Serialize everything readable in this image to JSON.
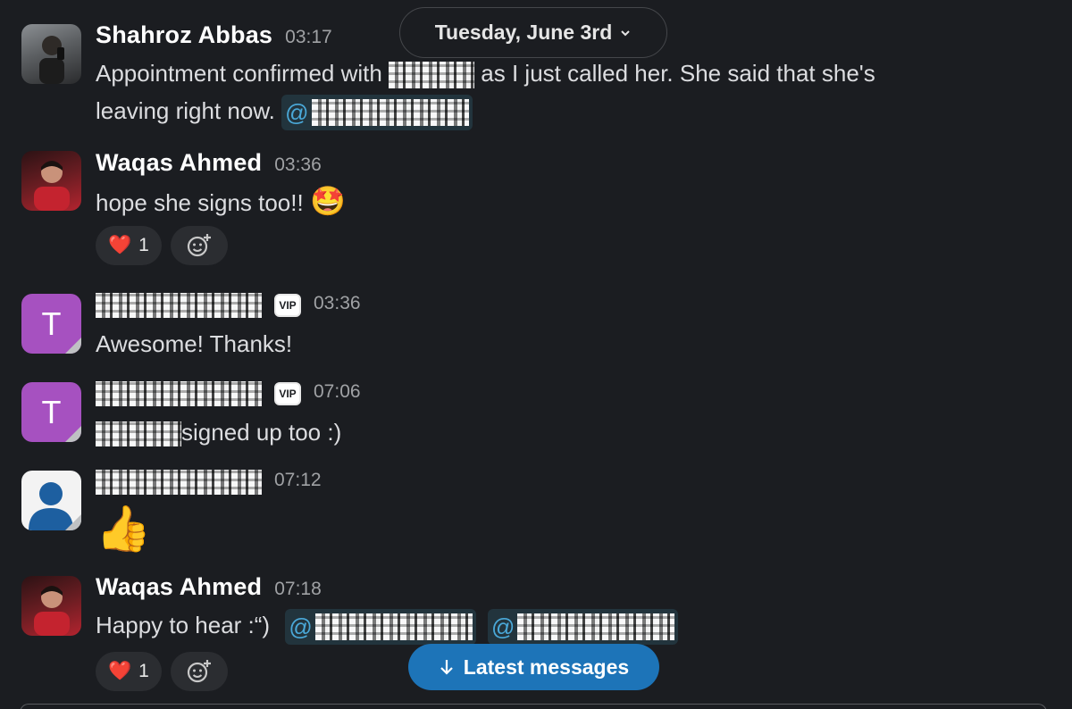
{
  "date_pill": {
    "label": "Tuesday, June 3rd",
    "chevron": "chevron-down-icon"
  },
  "messages": [
    {
      "author": "Shahroz Abbas",
      "time": "03:17",
      "text_a": "Appointment confirmed with",
      "text_b": "as I just called her. She said that she's",
      "text_c": "leaving right now.",
      "mention_prefix": "@"
    },
    {
      "author": "Waqas Ahmed",
      "time": "03:36",
      "text": "hope she signs too!!",
      "emoji": "🤩",
      "reaction_emoji": "❤️",
      "reaction_count": "1"
    },
    {
      "avatar_letter": "T",
      "badge": "VIP",
      "time": "03:36",
      "text": "Awesome! Thanks!"
    },
    {
      "avatar_letter": "T",
      "badge": "VIP",
      "time": "07:06",
      "text": "signed up too :)"
    },
    {
      "time": "07:12",
      "emoji": "👍"
    },
    {
      "author": "Waqas Ahmed",
      "time": "07:18",
      "text": "Happy to hear :“)",
      "mention_prefix": "@",
      "reaction_emoji": "❤️",
      "reaction_count": "1"
    }
  ],
  "latest_button": {
    "label": "Latest messages",
    "icon": "arrow-down-icon"
  },
  "colors": {
    "background": "#1b1d21",
    "accent": "#1d74b8",
    "mention": "#4aa8d8",
    "vip_avatar": "#a651c0"
  }
}
